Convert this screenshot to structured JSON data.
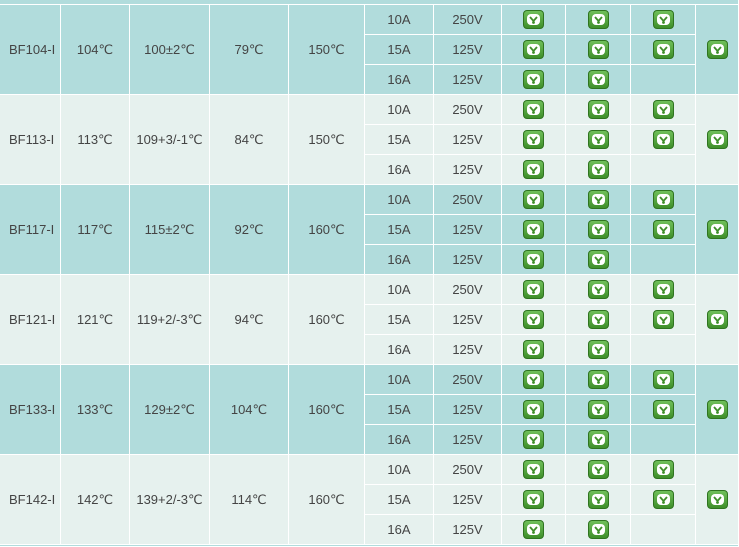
{
  "colors": {
    "row_dark": "#b1dcdc",
    "row_light": "#e6f1ee",
    "mark_green": "#4d9e36"
  },
  "marks_legend": {
    "icon": "certification-mark-icon"
  },
  "rows": [
    {
      "model": "BF104-I",
      "rated_temp": "104℃",
      "function_temp": "100±2℃",
      "hold_temp": "79℃",
      "max_temp": "150℃",
      "ratings": [
        {
          "current": "10A",
          "voltage": "250V",
          "c1": true,
          "c2": true,
          "c3": true
        },
        {
          "current": "15A",
          "voltage": "125V",
          "c1": true,
          "c2": true,
          "c3": true
        },
        {
          "current": "16A",
          "voltage": "125V",
          "c1": true,
          "c2": true,
          "c3": false
        }
      ],
      "c4": true
    },
    {
      "model": "BF113-I",
      "rated_temp": "113℃",
      "function_temp": "109+3/-1℃",
      "hold_temp": "84℃",
      "max_temp": "150℃",
      "ratings": [
        {
          "current": "10A",
          "voltage": "250V",
          "c1": true,
          "c2": true,
          "c3": true
        },
        {
          "current": "15A",
          "voltage": "125V",
          "c1": true,
          "c2": true,
          "c3": true
        },
        {
          "current": "16A",
          "voltage": "125V",
          "c1": true,
          "c2": true,
          "c3": false
        }
      ],
      "c4": true
    },
    {
      "model": "BF117-I",
      "rated_temp": "117℃",
      "function_temp": "115±2℃",
      "hold_temp": "92℃",
      "max_temp": "160℃",
      "ratings": [
        {
          "current": "10A",
          "voltage": "250V",
          "c1": true,
          "c2": true,
          "c3": true
        },
        {
          "current": "15A",
          "voltage": "125V",
          "c1": true,
          "c2": true,
          "c3": true
        },
        {
          "current": "16A",
          "voltage": "125V",
          "c1": true,
          "c2": true,
          "c3": false
        }
      ],
      "c4": true
    },
    {
      "model": "BF121-I",
      "rated_temp": "121℃",
      "function_temp": "119+2/-3℃",
      "hold_temp": "94℃",
      "max_temp": "160℃",
      "ratings": [
        {
          "current": "10A",
          "voltage": "250V",
          "c1": true,
          "c2": true,
          "c3": true
        },
        {
          "current": "15A",
          "voltage": "125V",
          "c1": true,
          "c2": true,
          "c3": true
        },
        {
          "current": "16A",
          "voltage": "125V",
          "c1": true,
          "c2": true,
          "c3": false
        }
      ],
      "c4": true
    },
    {
      "model": "BF133-I",
      "rated_temp": "133℃",
      "function_temp": "129±2℃",
      "hold_temp": "104℃",
      "max_temp": "160℃",
      "ratings": [
        {
          "current": "10A",
          "voltage": "250V",
          "c1": true,
          "c2": true,
          "c3": true
        },
        {
          "current": "15A",
          "voltage": "125V",
          "c1": true,
          "c2": true,
          "c3": true
        },
        {
          "current": "16A",
          "voltage": "125V",
          "c1": true,
          "c2": true,
          "c3": false
        }
      ],
      "c4": true
    },
    {
      "model": "BF142-I",
      "rated_temp": "142℃",
      "function_temp": "139+2/-3℃",
      "hold_temp": "114℃",
      "max_temp": "160℃",
      "ratings": [
        {
          "current": "10A",
          "voltage": "250V",
          "c1": true,
          "c2": true,
          "c3": true
        },
        {
          "current": "15A",
          "voltage": "125V",
          "c1": true,
          "c2": true,
          "c3": true
        },
        {
          "current": "16A",
          "voltage": "125V",
          "c1": true,
          "c2": true,
          "c3": false
        }
      ],
      "c4": true
    }
  ]
}
